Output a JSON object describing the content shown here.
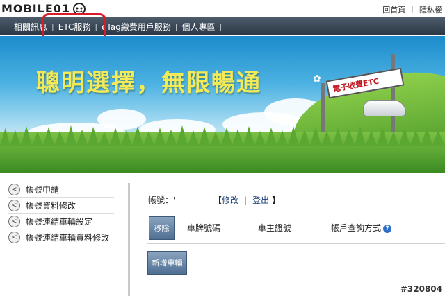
{
  "watermark_logo": "MOBILE01",
  "utility_links": [
    "回首頁",
    "隱私權"
  ],
  "nav": {
    "items": [
      "相關訊息",
      "ETC服務",
      "eTag繳費用戶服務",
      "個人專區"
    ],
    "separator": "|"
  },
  "banner": {
    "slogan": "聰明選擇，無限暢通",
    "gantry_sign": "電子收費ETC"
  },
  "sidebar": {
    "items": [
      {
        "label": "帳號申請",
        "icon": "chevron-left-circle-icon"
      },
      {
        "label": "帳號資料修改",
        "icon": "chevron-left-circle-icon"
      },
      {
        "label": "帳號連結車輛設定",
        "icon": "chevron-left-circle-icon"
      },
      {
        "label": "帳號連結車輛資料修改",
        "icon": "chevron-left-circle-icon"
      }
    ]
  },
  "account": {
    "label": "帳號：",
    "value": "'",
    "bracket_open": "【",
    "edit_link": "修改",
    "divider": "|",
    "logout_link": "登出",
    "bracket_close": "】"
  },
  "vehicle_table": {
    "delete_button": "移除",
    "columns": [
      "車牌號碼",
      "車主證號",
      "帳戶查詢方式"
    ],
    "help_icon": "?"
  },
  "add_vehicle_button": "新增車輛",
  "photo_id": "#320804",
  "colors": {
    "nav_bg": "#3b4756",
    "highlight": "#d61c2a",
    "button": "#5d7a9c",
    "slogan": "#f4ea58"
  }
}
